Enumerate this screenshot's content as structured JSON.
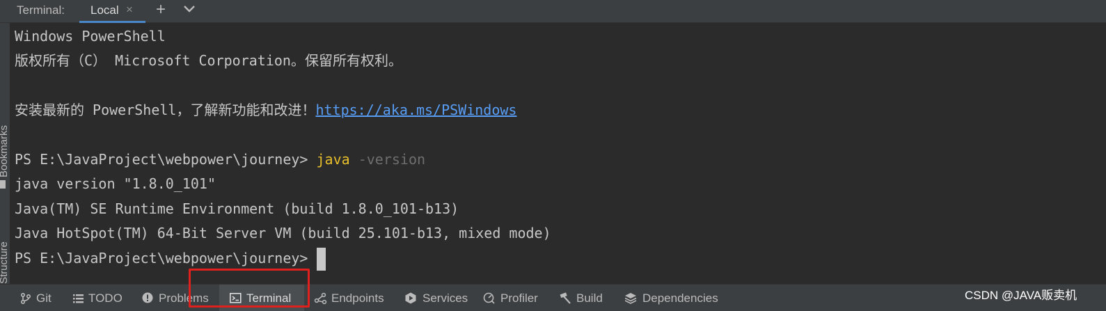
{
  "header": {
    "title": "Terminal:",
    "tab_label": "Local",
    "tab_close": "×",
    "add": "+"
  },
  "left_strip": {
    "bookmarks_label": "Bookmarks",
    "structure_label": "Structure"
  },
  "terminal": {
    "lines": [
      "Windows PowerShell",
      "版权所有（C） Microsoft Corporation。保留所有权利。",
      "",
      "安装最新的 PowerShell，了解新功能和改进！",
      "",
      "PS E:\\JavaProject\\webpower\\journey> ",
      "java version \"1.8.0_101\"",
      "Java(TM) SE Runtime Environment (build 1.8.0_101-b13)",
      "Java HotSpot(TM) 64-Bit Server VM (build 25.101-b13, mixed mode)",
      "PS E:\\JavaProject\\webpower\\journey> "
    ],
    "link": "https://aka.ms/PSWindows",
    "command": "java",
    "argument": "-version"
  },
  "bottom_bar": {
    "items": [
      "Git",
      "TODO",
      "Problems",
      "Terminal",
      "Endpoints",
      "Services",
      "Profiler",
      "Build",
      "Dependencies"
    ],
    "active": "Terminal"
  },
  "watermark": "CSDN @JAVA贩卖机",
  "colors": {
    "background": "#2b2b2b",
    "toolbar": "#3c3f41",
    "accent": "#4a88c7",
    "link": "#589df6",
    "command": "#e8bf2a",
    "highlight_box": "#e0201c"
  }
}
